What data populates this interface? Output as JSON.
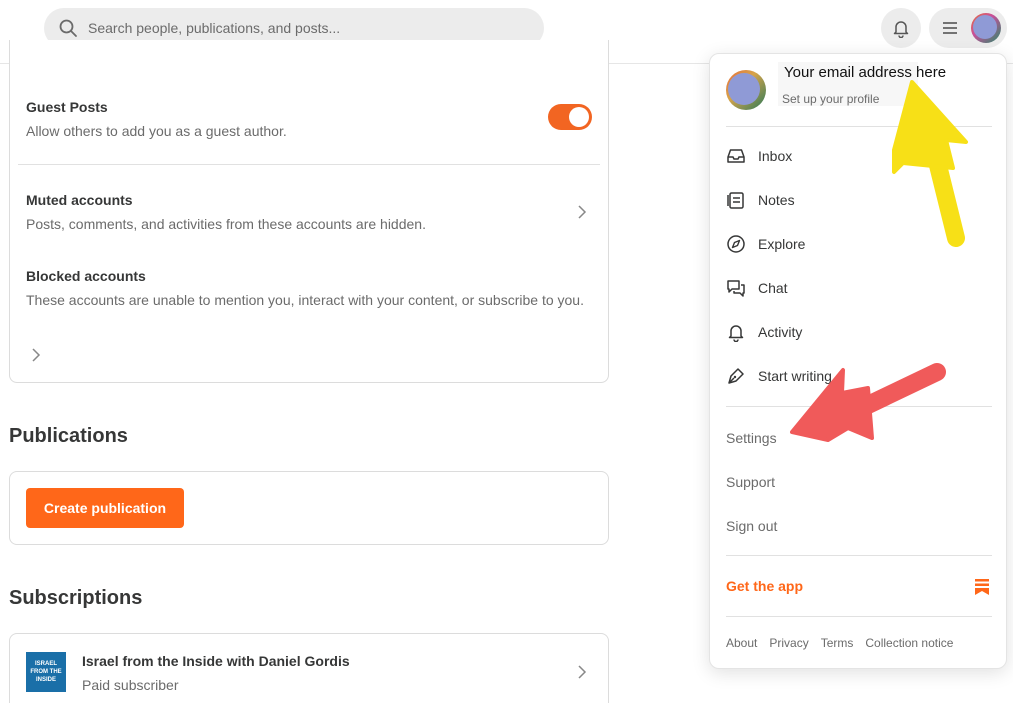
{
  "search": {
    "placeholder": "Search people, publications, and posts..."
  },
  "settings": {
    "guest_posts": {
      "title": "Guest Posts",
      "description": "Allow others to add you as a guest author.",
      "enabled": true
    },
    "muted": {
      "title": "Muted accounts",
      "description": "Posts, comments, and activities from these accounts are hidden."
    },
    "blocked": {
      "title": "Blocked accounts",
      "description": "These accounts are unable to mention you, interact with your content, or subscribe to you."
    }
  },
  "publications": {
    "heading": "Publications",
    "create_label": "Create publication"
  },
  "subscriptions": {
    "heading": "Subscriptions",
    "items": [
      {
        "name": "Israel from the Inside with Daniel Gordis",
        "status": "Paid subscriber",
        "logo_text": "ISRAEL FROM THE INSIDE"
      }
    ]
  },
  "menu": {
    "profile": {
      "email": "Your email address here",
      "subtitle": "Set up your profile"
    },
    "items": [
      {
        "label": "Inbox",
        "icon": "inbox-icon"
      },
      {
        "label": "Notes",
        "icon": "notes-icon"
      },
      {
        "label": "Explore",
        "icon": "compass-icon"
      },
      {
        "label": "Chat",
        "icon": "chat-icon"
      },
      {
        "label": "Activity",
        "icon": "bell-icon"
      },
      {
        "label": "Start writing",
        "icon": "pen-icon"
      }
    ],
    "secondary": [
      "Settings",
      "Support",
      "Sign out"
    ],
    "get_app": "Get the app",
    "footer": [
      "About",
      "Privacy",
      "Terms",
      "Collection notice"
    ]
  },
  "colors": {
    "accent": "#ff6719",
    "annotation_yellow": "#f7e017",
    "annotation_red": "#f05a5a"
  }
}
